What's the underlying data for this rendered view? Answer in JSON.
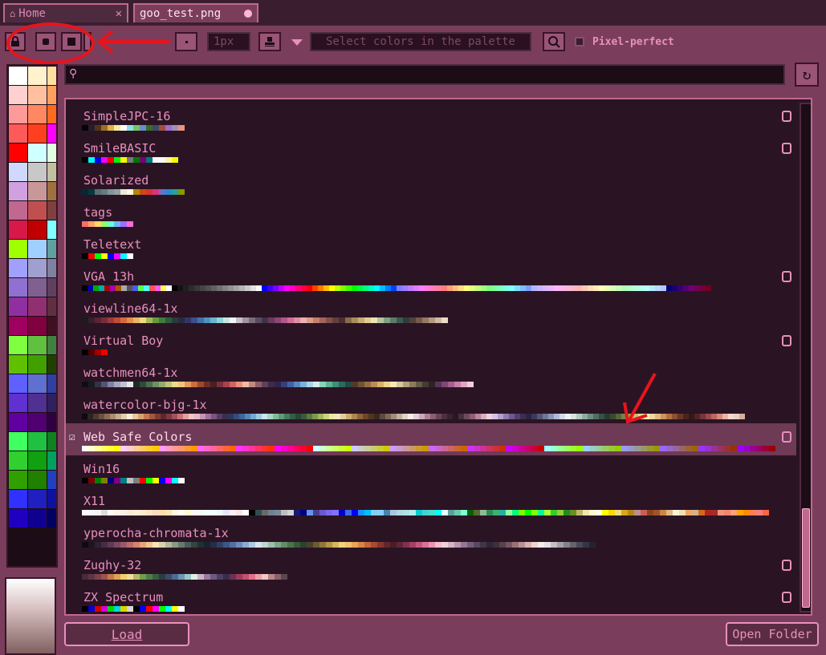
{
  "tabs": [
    {
      "label": "Home",
      "close_glyph": "✕"
    },
    {
      "label": "goo_test.png"
    }
  ],
  "toolbar": {
    "size_value": "1px",
    "palette_hint": "Select colors in the palette",
    "pixel_perfect_label": "Pixel-perfect"
  },
  "search": {
    "value": ""
  },
  "palettes": [
    {
      "name": "SimpleJPC-16",
      "badge": true,
      "selected": false,
      "colors": [
        "#050403",
        "#221f31",
        "#543516",
        "#9b6e2d",
        "#e1b047",
        "#f5ee9b",
        "#fefefe",
        "#8be1e0",
        "#7cc264",
        "#678fcb",
        "#316f23",
        "#404a68",
        "#a14d3f",
        "#a568d4",
        "#9a93b7",
        "#ea9182"
      ]
    },
    {
      "name": "SmileBASIC",
      "badge": true,
      "selected": false,
      "colors": [
        "#000000",
        "#00f8f8",
        "#0000f8",
        "#f800f8",
        "#f80000",
        "#00f800",
        "#f8f800",
        "#787878",
        "#007800",
        "#780078",
        "#007878",
        "#f8f8f8",
        "#f8f8f8",
        "#f8f8a0",
        "#f8f800"
      ]
    },
    {
      "name": "Solarized",
      "badge": false,
      "selected": false,
      "colors": [
        "#002b36",
        "#073642",
        "#586e75",
        "#657b83",
        "#839496",
        "#93a1a1",
        "#eee8d5",
        "#fdf6e3",
        "#b58900",
        "#cb4b16",
        "#dc322f",
        "#d33682",
        "#6c71c4",
        "#268bd2",
        "#2aa198",
        "#859900"
      ]
    },
    {
      "name": "tags",
      "badge": false,
      "selected": false,
      "colors": [
        "#ff6b6b",
        "#ffa36b",
        "#ffd76b",
        "#8cff6b",
        "#6bffd0",
        "#6bb8ff",
        "#a36bff",
        "#ff6bd7"
      ]
    },
    {
      "name": "Teletext",
      "badge": false,
      "selected": false,
      "colors": [
        "#000000",
        "#ff0000",
        "#00ff00",
        "#ffff00",
        "#0000ff",
        "#ff00ff",
        "#00ffff",
        "#ffffff"
      ]
    },
    {
      "name": "VGA 13h",
      "badge": true,
      "selected": false,
      "colors": [
        "#000000",
        "#0000aa",
        "#00aa00",
        "#00aaaa",
        "#aa0000",
        "#aa00aa",
        "#aa5500",
        "#aaaaaa",
        "#555555",
        "#5555ff",
        "#55ff55",
        "#55ffff",
        "#ff5555",
        "#ff55ff",
        "#ffff55",
        "#ffffff",
        "#000000",
        "#141414",
        "#202020",
        "#2c2c2c",
        "#383838",
        "#454545",
        "#515151",
        "#616161",
        "#717171",
        "#828282",
        "#929292",
        "#a2a2a2",
        "#b6b6b6",
        "#cbcbcb",
        "#e3e3e3",
        "#ffffff",
        "#0000ff",
        "#4100ff",
        "#7d00ff",
        "#be00ff",
        "#ff00ff",
        "#ff00be",
        "#ff007d",
        "#ff0041",
        "#ff0000",
        "#ff4100",
        "#ff7d00",
        "#ffbe00",
        "#ffff00",
        "#beff00",
        "#7dff00",
        "#41ff00",
        "#00ff00",
        "#00ff41",
        "#00ff7d",
        "#00ffbe",
        "#00ffff",
        "#00beff",
        "#007dff",
        "#0041ff",
        "#7d7dff",
        "#9e7dff",
        "#be7dff",
        "#df7dff",
        "#ff7dff",
        "#ff7ddf",
        "#ff7dbe",
        "#ff7d9e",
        "#ff7d7d",
        "#ff9e7d",
        "#ffbe7d",
        "#ffdf7d",
        "#ffff7d",
        "#dfff7d",
        "#beff7d",
        "#9eff7d",
        "#7dff7d",
        "#7dff9e",
        "#7dffbe",
        "#7dffdf",
        "#7dffff",
        "#7ddfff",
        "#7dbeff",
        "#7d9eff",
        "#b6b6ff",
        "#c7b6ff",
        "#dbb6ff",
        "#ebb6ff",
        "#ffb6ff",
        "#ffb6eb",
        "#ffb6db",
        "#ffb6c7",
        "#ffb6b6",
        "#ffc7b6",
        "#ffdbb6",
        "#ffebb6",
        "#ffffb6",
        "#ebffb6",
        "#dbffb6",
        "#c7ffb6",
        "#b6ffb6",
        "#b6ffc7",
        "#b6ffdb",
        "#b6ffeb",
        "#b6ffff",
        "#b6ebff",
        "#b6dbff",
        "#b6c7ff",
        "#000071",
        "#1c0071",
        "#380071",
        "#550071",
        "#710071",
        "#71005a",
        "#710038",
        "#71001c"
      ]
    },
    {
      "name": "viewline64-1x",
      "badge": false,
      "selected": false,
      "colors": [
        "#1b1b1e",
        "#3b1e29",
        "#5a2433",
        "#7a2c3b",
        "#9c3a3c",
        "#be4b3c",
        "#d8693c",
        "#e58e4a",
        "#eab564",
        "#f1d884",
        "#a7b951",
        "#6a9840",
        "#437a3e",
        "#2d5c3c",
        "#263d3b",
        "#2a2a3e",
        "#34346a",
        "#3d4f8c",
        "#4370a6",
        "#4f94bf",
        "#6bb5d1",
        "#93d2dc",
        "#c3e8e4",
        "#f4f4f4",
        "#c9c1c5",
        "#a0949d",
        "#7b6c7a",
        "#594c5e",
        "#3e3347",
        "#6a3a5f",
        "#8e4676",
        "#b15688",
        "#cf6d96",
        "#e08da2",
        "#eab1b6",
        "#d99d86",
        "#c2806d",
        "#a2655a",
        "#82504a",
        "#653e3d",
        "#4b2e31",
        "#8b6b4c",
        "#ab8c5d",
        "#c9ad73",
        "#e1cd91",
        "#ede4b7",
        "#b4c4a1",
        "#83a081",
        "#5a7d66",
        "#3e5a50",
        "#2b3d3e",
        "#52423a",
        "#725b4c",
        "#947963",
        "#b3997e",
        "#d0ba9f",
        "#e9ddc7"
      ]
    },
    {
      "name": "Virtual Boy",
      "badge": true,
      "selected": false,
      "colors": [
        "#000000",
        "#550000",
        "#a40000",
        "#ef0000"
      ]
    },
    {
      "name": "watchmen64-1x",
      "badge": false,
      "selected": false,
      "colors": [
        "#0e0e12",
        "#1a1a24",
        "#333346",
        "#535373",
        "#8080a4",
        "#a6a6bf",
        "#c1c1d2",
        "#e6e6ec",
        "#1f2b25",
        "#2f4a3a",
        "#4b6e4f",
        "#6e8f63",
        "#93a96f",
        "#bdc47a",
        "#e4dc8f",
        "#f1c37b",
        "#e39b59",
        "#c7703c",
        "#9c4a2c",
        "#6e2e26",
        "#4a1f24",
        "#7b2e3c",
        "#a8424e",
        "#cf6465",
        "#e68f7e",
        "#efb9a2",
        "#c08b84",
        "#8f5f69",
        "#62405a",
        "#3f2a48",
        "#2c2451",
        "#363f7d",
        "#4460a4",
        "#5888c4",
        "#7bb1da",
        "#a7d5e6",
        "#d2ecea",
        "#8ad3b6",
        "#5bb494",
        "#3f8f78",
        "#2d6a5e",
        "#234a45",
        "#4d3a2b",
        "#6e5437",
        "#926f43",
        "#b78f52",
        "#d8b166",
        "#f0d38a",
        "#f6e9b8",
        "#d7c79b",
        "#b2a17a",
        "#8b7c5e",
        "#645a46",
        "#443c33",
        "#2a2522",
        "#5a3358",
        "#7f4774",
        "#a55f90",
        "#c77fa8",
        "#e0a6c1",
        "#f2cdda"
      ]
    },
    {
      "name": "watercolor-bjg-1x",
      "badge": false,
      "selected": false,
      "colors": [
        "#0b0a0c",
        "#2d2420",
        "#4d3a2e",
        "#6b5140",
        "#8b6d55",
        "#aa8c6e",
        "#c7ad8d",
        "#e1ceb1",
        "#f4ecdc",
        "#e8c8a0",
        "#d8a274",
        "#c27a52",
        "#a3583d",
        "#7e3d31",
        "#5a2a27",
        "#7b3a44",
        "#a3525b",
        "#c8737a",
        "#e2a0a0",
        "#f0c8c0",
        "#e4b8c8",
        "#c894b0",
        "#a07098",
        "#785480",
        "#543c62",
        "#3c2e4a",
        "#2c3858",
        "#344c78",
        "#40669a",
        "#5488b8",
        "#74aad0",
        "#9ccbe2",
        "#c8e6ee",
        "#a8d8c4",
        "#80bc9c",
        "#5e9c78",
        "#447c5a",
        "#345e44",
        "#28463a",
        "#3c5a3a",
        "#587a44",
        "#7c9a50",
        "#a4b860",
        "#cad47c",
        "#e8eaa4",
        "#f2e6c0",
        "#e4cc98",
        "#ccaa70",
        "#ae8650",
        "#8c6438",
        "#6c4828",
        "#503420",
        "#3a2820",
        "#5c4a40",
        "#7e6a5c",
        "#a08c7c",
        "#c2b0a0",
        "#e2d4c6",
        "#f6eee8",
        "#e6d0d8",
        "#cca8b8",
        "#ac8094",
        "#8a5e74",
        "#6a4456",
        "#4c3040",
        "#362230",
        "#281820",
        "#483040",
        "#6c4c5c",
        "#925e74",
        "#b6869a",
        "#d8aec0",
        "#eed4e0",
        "#d6c2e4",
        "#b49ece",
        "#907ab0",
        "#6e5890",
        "#52406e",
        "#3a2e52",
        "#2a2440",
        "#3c3a5c",
        "#545678",
        "#6e7698",
        "#8c98b8",
        "#b0bcd4",
        "#d4dcea",
        "#eef2f6",
        "#d6e4dc",
        "#b4cac0",
        "#90ac9e",
        "#6c8c7e",
        "#4e6e60",
        "#365244",
        "#263a30",
        "#3a4a2c",
        "#566638",
        "#788446",
        "#9ca458",
        "#c2c270",
        "#e2de90",
        "#f4f0b8",
        "#f0d8a0",
        "#e2b880",
        "#cc9460",
        "#b07044",
        "#8c5030",
        "#6a3624",
        "#4a241c",
        "#34181a",
        "#50242a",
        "#74343a",
        "#9a4a4a",
        "#bc6660",
        "#d68a7c",
        "#ecb4a4",
        "#f6d8cc",
        "#ead0c0",
        "#d4b09c"
      ]
    },
    {
      "name": "Web Safe Colors",
      "badge": true,
      "selected": true,
      "colors": [
        "#ffffff",
        "#ffffcc",
        "#ffff99",
        "#ffff66",
        "#ffff33",
        "#ffff00",
        "#ffccff",
        "#ffcccc",
        "#ffcc99",
        "#ffcc66",
        "#ffcc33",
        "#ffcc00",
        "#ff99ff",
        "#ff99cc",
        "#ff9999",
        "#ff9966",
        "#ff9933",
        "#ff9900",
        "#ff66ff",
        "#ff66cc",
        "#ff6699",
        "#ff6666",
        "#ff6633",
        "#ff6600",
        "#ff33ff",
        "#ff33cc",
        "#ff3399",
        "#ff3366",
        "#ff3333",
        "#ff3300",
        "#ff00ff",
        "#ff00cc",
        "#ff0099",
        "#ff0066",
        "#ff0033",
        "#ff0000",
        "#ccffff",
        "#ccffcc",
        "#ccff99",
        "#ccff66",
        "#ccff33",
        "#ccff00",
        "#ccccff",
        "#cccccc",
        "#cccc99",
        "#cccc66",
        "#cccc33",
        "#cccc00",
        "#cc99ff",
        "#cc99cc",
        "#cc9999",
        "#cc9966",
        "#cc9933",
        "#cc9900",
        "#cc66ff",
        "#cc66cc",
        "#cc6699",
        "#cc6666",
        "#cc6633",
        "#cc6600",
        "#cc33ff",
        "#cc33cc",
        "#cc3399",
        "#cc3366",
        "#cc3333",
        "#cc3300",
        "#cc00ff",
        "#cc00cc",
        "#cc0099",
        "#cc0066",
        "#cc0033",
        "#cc0000",
        "#99ffff",
        "#99ffcc",
        "#99ff99",
        "#99ff66",
        "#99ff33",
        "#99ff00",
        "#99ccff",
        "#99cccc",
        "#99cc99",
        "#99cc66",
        "#99cc33",
        "#99cc00",
        "#9999ff",
        "#9999cc",
        "#999999",
        "#999966",
        "#999933",
        "#999900",
        "#9966ff",
        "#9966cc",
        "#996699",
        "#996666",
        "#996633",
        "#996600",
        "#9933ff",
        "#9933cc",
        "#993399",
        "#993366",
        "#993333",
        "#993300",
        "#9900ff",
        "#9900cc",
        "#990099",
        "#990066",
        "#990033",
        "#990000"
      ]
    },
    {
      "name": "Win16",
      "badge": false,
      "selected": false,
      "colors": [
        "#000000",
        "#800000",
        "#008000",
        "#808000",
        "#000080",
        "#800080",
        "#008080",
        "#c0c0c0",
        "#808080",
        "#ff0000",
        "#00ff00",
        "#ffff00",
        "#0000ff",
        "#ff00ff",
        "#00ffff",
        "#ffffff"
      ]
    },
    {
      "name": "X11",
      "badge": false,
      "selected": false,
      "colors": [
        "#fffafa",
        "#f8f8ff",
        "#f5f5f5",
        "#dcdcdc",
        "#fffaf0",
        "#fdf5e6",
        "#faf0e6",
        "#faebd7",
        "#ffefd5",
        "#ffebcd",
        "#ffe4c4",
        "#ffdab9",
        "#ffdead",
        "#ffe4b5",
        "#fff8dc",
        "#fffff0",
        "#fffacd",
        "#fff5ee",
        "#f0fff0",
        "#f5fffa",
        "#f0ffff",
        "#f0f8ff",
        "#e6e6fa",
        "#fff0f5",
        "#ffe4e1",
        "#ffffff",
        "#000000",
        "#2f4f4f",
        "#696969",
        "#708090",
        "#778899",
        "#bebebe",
        "#d3d3d3",
        "#191970",
        "#000080",
        "#6495ed",
        "#483d8b",
        "#6a5acd",
        "#7b68ee",
        "#8470ff",
        "#0000cd",
        "#4169e1",
        "#0000ff",
        "#1e90ff",
        "#00bfff",
        "#87ceeb",
        "#87cefa",
        "#4682b4",
        "#b0c4de",
        "#add8e6",
        "#b0e0e6",
        "#afeeee",
        "#00ced1",
        "#48d1cc",
        "#40e0d0",
        "#00ffff",
        "#e0ffff",
        "#5f9ea0",
        "#66cdaa",
        "#7fffd4",
        "#006400",
        "#556b2f",
        "#8fbc8f",
        "#2e8b57",
        "#3cb371",
        "#20b2aa",
        "#98fb98",
        "#00ff7f",
        "#7cfc00",
        "#00ff00",
        "#7fff00",
        "#00fa9a",
        "#adff2f",
        "#32cd32",
        "#9acd32",
        "#228b22",
        "#6b8e23",
        "#bdb76b",
        "#eee8aa",
        "#fafad2",
        "#ffffe0",
        "#ffff00",
        "#ffd700",
        "#eedd82",
        "#daa520",
        "#b8860b",
        "#bc8f8f",
        "#cd5c5c",
        "#8b4513",
        "#a0522d",
        "#cd853f",
        "#deb887",
        "#f5f5dc",
        "#f5deb3",
        "#f4a460",
        "#d2b48c",
        "#d2691e",
        "#b22222",
        "#a52a2a",
        "#e9967a",
        "#fa8072",
        "#ffa07a",
        "#ffa500",
        "#ff8c00",
        "#ff7f50",
        "#f08080",
        "#ff6347"
      ]
    },
    {
      "name": "yperocha-chromata-1x",
      "badge": false,
      "selected": false,
      "colors": [
        "#0d0b10",
        "#1b1520",
        "#2e2133",
        "#442d45",
        "#5e3a55",
        "#7c4862",
        "#9c586a",
        "#bb6b6d",
        "#d6836e",
        "#e9a27a",
        "#f2c492",
        "#f6e3b6",
        "#d9d2b0",
        "#b2b69a",
        "#8a9982",
        "#657b6c",
        "#475e58",
        "#324542",
        "#22302f",
        "#1a2230",
        "#222e48",
        "#2e3f66",
        "#3e5586",
        "#536ea3",
        "#6c8bbd",
        "#8ba9d2",
        "#b0c8e2",
        "#d6e5ef",
        "#c0d6cf",
        "#9ebfab",
        "#7ea686",
        "#628d66",
        "#4b734c",
        "#385a3a",
        "#2a422e",
        "#4a4228",
        "#6a5c30",
        "#8e783a",
        "#b39648",
        "#d6b65e",
        "#eed47c",
        "#f0c26a",
        "#e8a554",
        "#d98544",
        "#c4653a",
        "#a74a34",
        "#86352f",
        "#64262a",
        "#4a1d26",
        "#622438",
        "#82304e",
        "#a44066",
        "#c2567e",
        "#da7294",
        "#ec94ad",
        "#f6bac8",
        "#f0d0d8",
        "#d6b4c6",
        "#b696b0",
        "#947896",
        "#745e7c",
        "#584862",
        "#40364a",
        "#2c2636",
        "#3e2f3a",
        "#58414b",
        "#76575f",
        "#987279",
        "#bb9194",
        "#d9b3b1",
        "#eed3ce",
        "#f8ecea",
        "#e2e0e0",
        "#c4c0c4",
        "#a4a0a8",
        "#84808c",
        "#666272",
        "#4a4858",
        "#343442",
        "#242430"
      ]
    },
    {
      "name": "Zughy-32",
      "badge": true,
      "selected": false,
      "colors": [
        "#472d3c",
        "#5e3643",
        "#7a444a",
        "#a0524e",
        "#c67a4d",
        "#e2a155",
        "#f2cd6d",
        "#eedd98",
        "#b8b56f",
        "#6f9e4c",
        "#4d7d45",
        "#3b5c42",
        "#2a3d3e",
        "#3e4a6d",
        "#4f6b92",
        "#6a99b5",
        "#9ec4c8",
        "#dcefe5",
        "#c9b3c4",
        "#9a7a9e",
        "#6d5a7f",
        "#4d3f62",
        "#382d4a",
        "#6e3052",
        "#9a3d5e",
        "#c2506e",
        "#e1708a",
        "#ef9fa9",
        "#f2c6c6",
        "#b9858a",
        "#8a6268",
        "#5d4650"
      ]
    },
    {
      "name": "ZX Spectrum",
      "badge": true,
      "selected": false,
      "colors": [
        "#000000",
        "#0000d7",
        "#d70000",
        "#d700d7",
        "#00d700",
        "#00d7d7",
        "#d7d700",
        "#d7d7d7",
        "#000000",
        "#0000ff",
        "#ff0000",
        "#ff00ff",
        "#00ff00",
        "#00ffff",
        "#ffff00",
        "#ffffff"
      ]
    }
  ],
  "left_palette_colors": [
    "#ffffff",
    "#fff2cc",
    "#ffe0a0",
    "#ffd0d0",
    "#ffc0a0",
    "#ffa060",
    "#ff9a9a",
    "#ff8860",
    "#ff6a20",
    "#ff5a5a",
    "#ff4020",
    "#ff00ff",
    "#ff0000",
    "#d0ffff",
    "#e0ffe0",
    "#d0d8ff",
    "#c8c8c8",
    "#c0c0a0",
    "#d0a0e0",
    "#c89898",
    "#a07040",
    "#c06890",
    "#c05050",
    "#804040",
    "#d81848",
    "#c00000",
    "#80ffff",
    "#a0ff00",
    "#a0d0ff",
    "#60a0a0",
    "#a0a0ff",
    "#a0a0d0",
    "#8080a0",
    "#9070d0",
    "#806090",
    "#604060",
    "#9030a0",
    "#903070",
    "#603040",
    "#a00060",
    "#800040",
    "#401020",
    "#80ff40",
    "#60c040",
    "#408040",
    "#60c000",
    "#40a000",
    "#204000",
    "#6060ff",
    "#6070d0",
    "#3040a0",
    "#6030d0",
    "#503090",
    "#302060",
    "#6000a0",
    "#500070",
    "#300040",
    "#40ff60",
    "#20c040",
    "#108020",
    "#30d030",
    "#10a010",
    "#00a060",
    "#30a000",
    "#208000",
    "#2040c0",
    "#3030ff",
    "#2020c0",
    "#1010a0",
    "#2000c0",
    "#100090",
    "#000060"
  ],
  "buttons": {
    "load": "Load",
    "open_folder": "Open Folder"
  }
}
